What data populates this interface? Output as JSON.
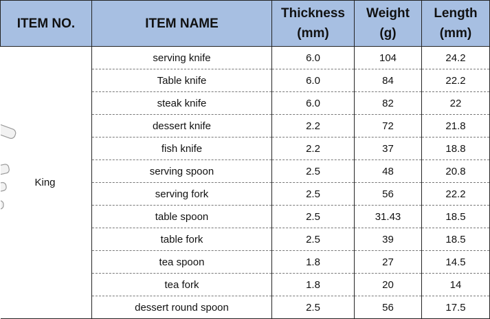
{
  "headers": {
    "item_no": "ITEM NO.",
    "item_name": "ITEM NAME",
    "thickness_1": "Thickness",
    "thickness_2": "(mm)",
    "weight_1": "Weight",
    "weight_2": "(g)",
    "length_1": "Length",
    "length_2": "(mm)"
  },
  "item_no": "King",
  "rows": [
    {
      "name": "serving knife",
      "thickness": "6.0",
      "weight": "104",
      "length": "24.2"
    },
    {
      "name": "Table knife",
      "thickness": "6.0",
      "weight": "84",
      "length": "22.2"
    },
    {
      "name": "steak knife",
      "thickness": "6.0",
      "weight": "82",
      "length": "22"
    },
    {
      "name": "dessert knife",
      "thickness": "2.2",
      "weight": "72",
      "length": "21.8"
    },
    {
      "name": "fish knife",
      "thickness": "2.2",
      "weight": "37",
      "length": "18.8"
    },
    {
      "name": "serving spoon",
      "thickness": "2.5",
      "weight": "48",
      "length": "20.8"
    },
    {
      "name": "serving fork",
      "thickness": "2.5",
      "weight": "56",
      "length": "22.2"
    },
    {
      "name": "table spoon",
      "thickness": "2.5",
      "weight": "31.43",
      "length": "18.5"
    },
    {
      "name": "table fork",
      "thickness": "2.5",
      "weight": "39",
      "length": "18.5"
    },
    {
      "name": "tea spoon",
      "thickness": "1.8",
      "weight": "27",
      "length": "14.5"
    },
    {
      "name": "tea fork",
      "thickness": "1.8",
      "weight": "20",
      "length": "14"
    },
    {
      "name": "dessert round spoon",
      "thickness": "2.5",
      "weight": "56",
      "length": "17.5"
    }
  ]
}
